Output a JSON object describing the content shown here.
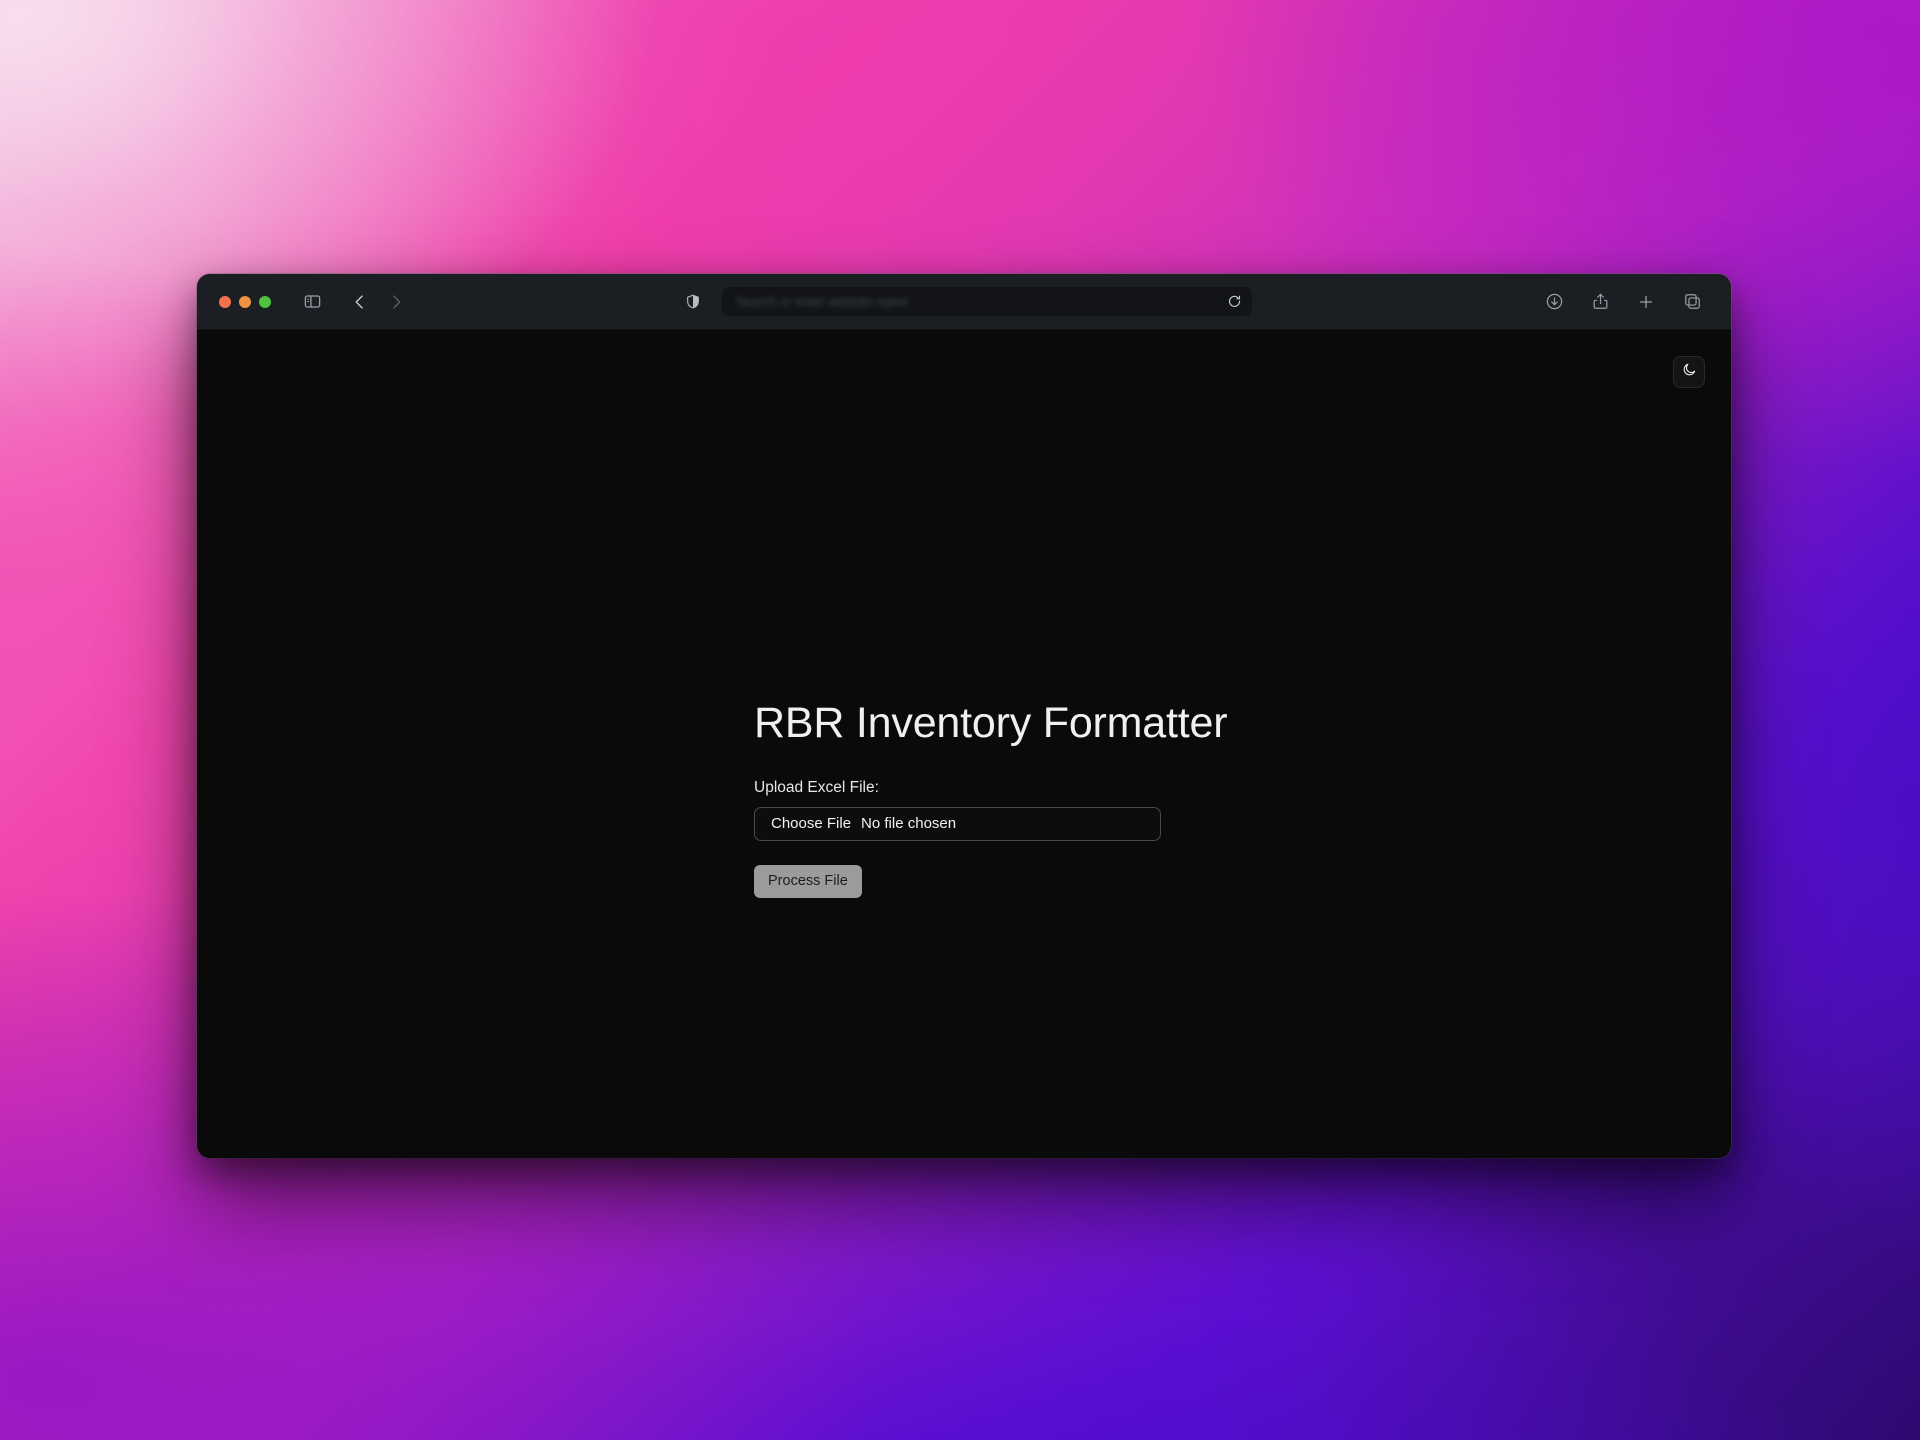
{
  "wallpaper": {
    "gradient_colors": [
      "#f3c9e4",
      "#ef3fa8",
      "#c72cc0",
      "#6a12cf",
      "#2c0d5e"
    ]
  },
  "browser": {
    "traffic_lights": [
      {
        "name": "close",
        "color": "#f2734a"
      },
      {
        "name": "minimize",
        "color": "#ef9244"
      },
      {
        "name": "zoom",
        "color": "#4ec33d"
      }
    ],
    "toolbar_left": [
      {
        "name": "sidebar-toggle",
        "icon": "sidebar-icon"
      },
      {
        "name": "back",
        "icon": "chevron-left-icon"
      },
      {
        "name": "forward",
        "icon": "chevron-right-icon"
      }
    ],
    "privacy_icon": "shield-icon",
    "address": {
      "value": "",
      "placeholder": "Search or enter website name",
      "redacted": true
    },
    "reload_icon": "reload-icon",
    "toolbar_right": [
      {
        "name": "downloads",
        "icon": "download-circle-icon"
      },
      {
        "name": "share",
        "icon": "share-icon"
      },
      {
        "name": "new-tab",
        "icon": "plus-icon"
      },
      {
        "name": "tab-overview",
        "icon": "copy-tabs-icon"
      }
    ]
  },
  "page": {
    "title": "RBR Inventory Formatter",
    "theme_toggle": {
      "icon": "moon-icon",
      "accent": "#141414"
    },
    "upload": {
      "label": "Upload Excel File:",
      "choose_button_label": "Choose File",
      "file_status": "No file chosen"
    },
    "actions": {
      "process_label": "Process File",
      "process_bg": "#9b9b9b"
    },
    "background": "#0a0a0a"
  }
}
